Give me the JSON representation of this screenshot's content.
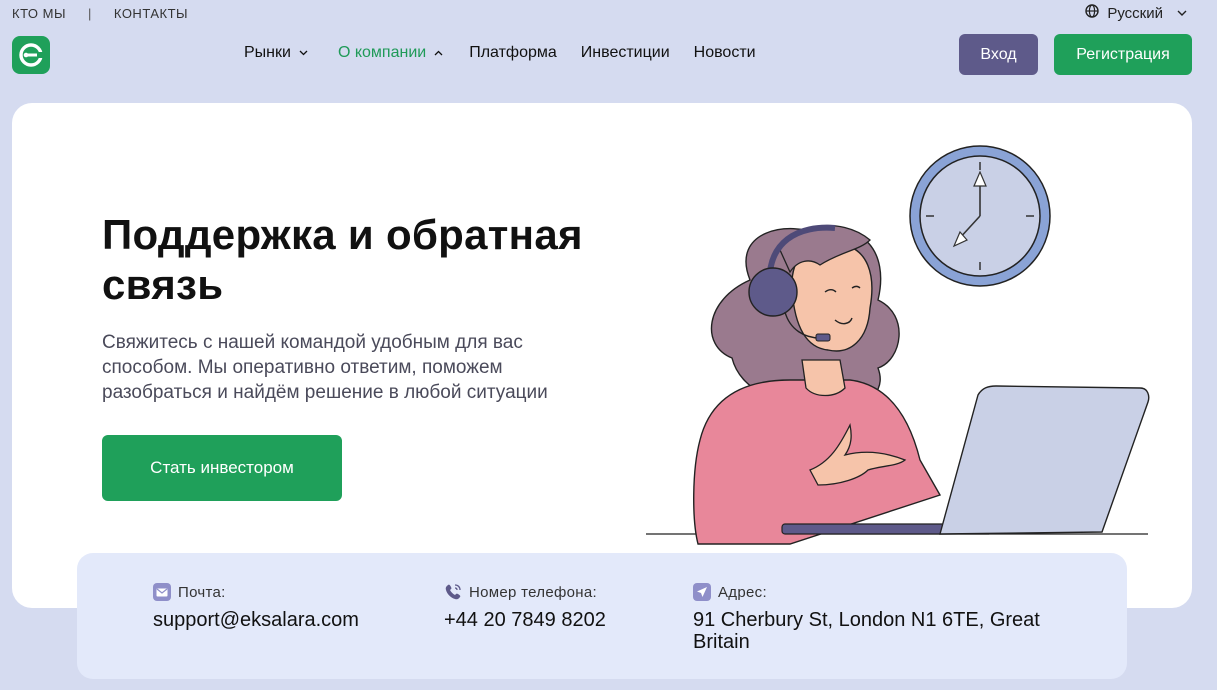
{
  "topbar": {
    "about": "КТО МЫ",
    "separator": "|",
    "contacts": "КОНТАКТЫ"
  },
  "language": {
    "label": "Русский",
    "icon": "globe-icon"
  },
  "nav": {
    "items": [
      {
        "label": "Рынки",
        "has_dropdown": true
      },
      {
        "label": "О компании",
        "has_dropdown": true,
        "active": true
      },
      {
        "label": "Платформа",
        "has_dropdown": false
      },
      {
        "label": "Инвестиции",
        "has_dropdown": false
      },
      {
        "label": "Новости",
        "has_dropdown": false
      }
    ]
  },
  "auth": {
    "login": "Вход",
    "register": "Регистрация"
  },
  "hero": {
    "title": "Поддержка и обратная связь",
    "description": "Свяжитесь с нашей командой удобным для вас способом. Мы оперативно ответим, поможем разобраться и найдём решение в любой ситуации",
    "cta": "Стать инвестором"
  },
  "contacts": {
    "email": {
      "label": "Почта:",
      "value": "support@eksalara.com",
      "icon": "mail-icon"
    },
    "phone": {
      "label": "Номер телефона:",
      "value": "+44 20 7849 8202",
      "icon": "phone-icon"
    },
    "address": {
      "label": "Адрес:",
      "value": "91 Cherbury St, London N1 6TE, Great Britain",
      "icon": "location-icon"
    }
  },
  "colors": {
    "brand_green": "#1fa05a",
    "login_purple": "#5e5a8a",
    "page_bg": "#d5dbf0",
    "contacts_bg": "#e3e9fa"
  }
}
